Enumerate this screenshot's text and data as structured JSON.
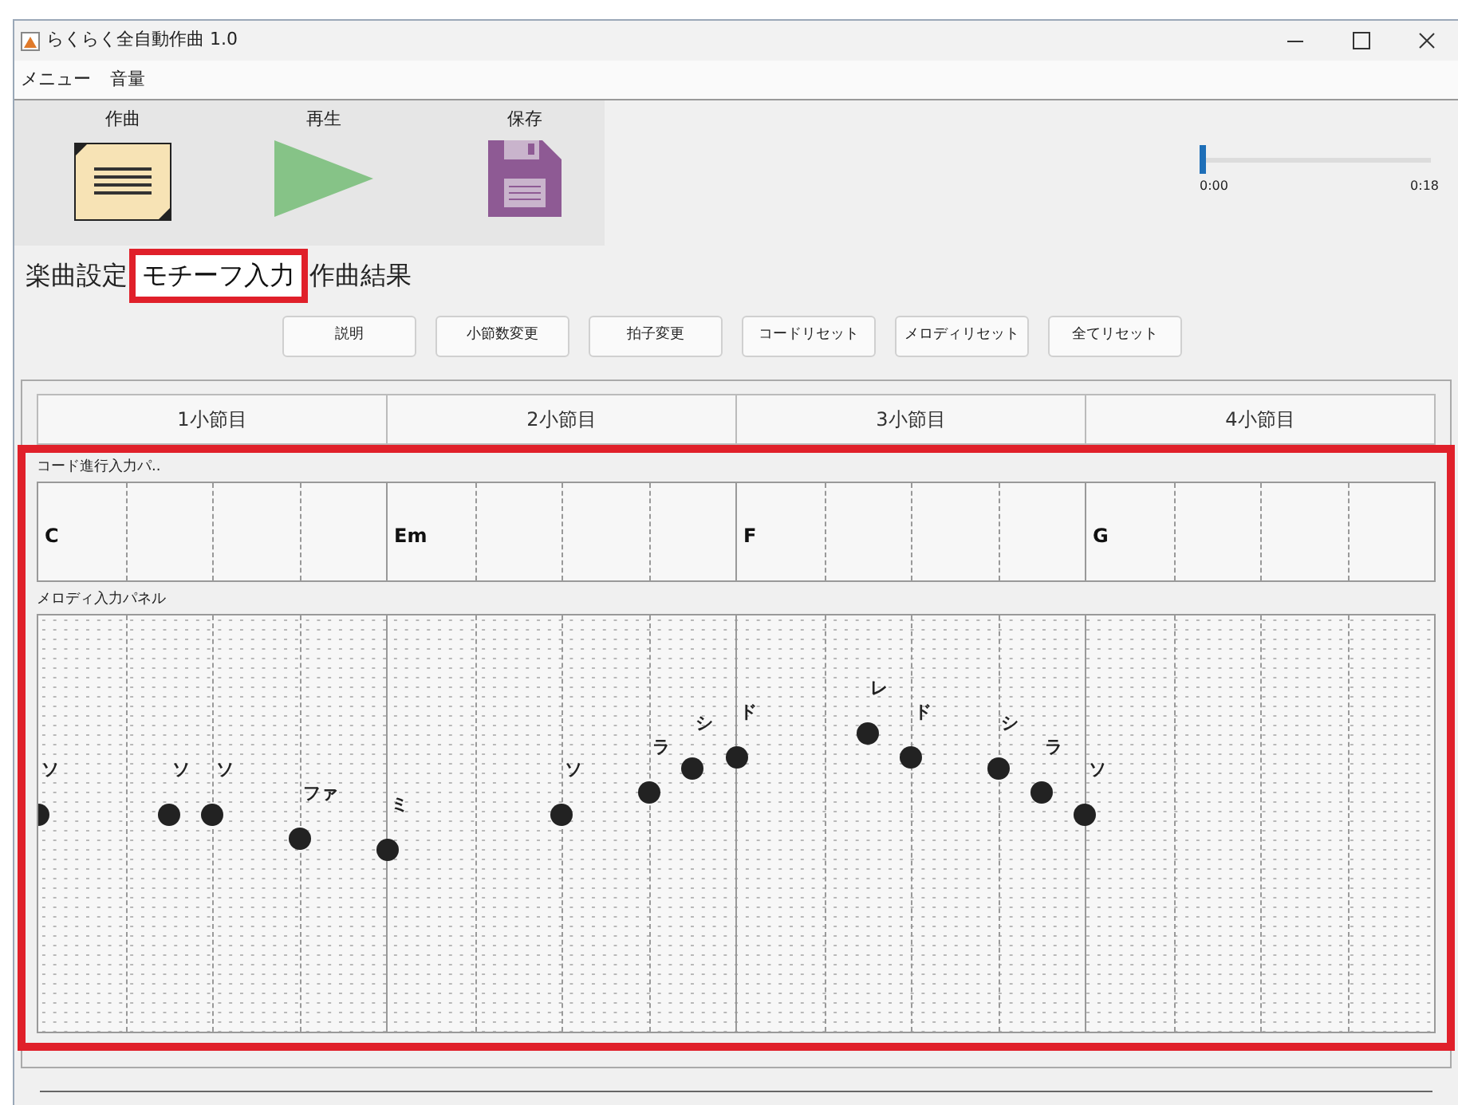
{
  "window": {
    "title": "らくらく全自動作曲 1.0"
  },
  "menu": [
    "メニュー",
    "音量"
  ],
  "toolbar": [
    {
      "kind": "compose",
      "label": "作曲"
    },
    {
      "kind": "play",
      "label": "再生"
    },
    {
      "kind": "save",
      "label": "保存"
    }
  ],
  "playback": {
    "level": 0,
    "start": "0:00",
    "end": "0:18"
  },
  "tabs": [
    {
      "label": "楽曲設定",
      "selected": false
    },
    {
      "label": "モチーフ入力",
      "selected": true
    },
    {
      "label": "作曲結果",
      "selected": false
    }
  ],
  "buttons": [
    "説明",
    "小節数変更",
    "拍子変更",
    "コードリセット",
    "メロディリセット",
    "全てリセット"
  ],
  "chord_panel": {
    "title": "コード進行入力パ.."
  },
  "melody_panel": {
    "title": "メロディ入力パネル"
  },
  "measures": [
    {
      "label": "1小節目",
      "chord": "C",
      "slots": [
        {
          "kind": "g4",
          "label": "ソ"
        },
        {
          "kind": "rest"
        },
        {
          "kind": "rest"
        },
        {
          "kind": "g4",
          "label": "ソ"
        },
        {
          "kind": "g4",
          "label": "ソ"
        },
        {
          "kind": "rest"
        },
        {
          "kind": "f4",
          "label": "ファ"
        },
        {
          "kind": "rest"
        }
      ]
    },
    {
      "label": "2小節目",
      "chord": "Em",
      "slots": [
        {
          "kind": "e4",
          "label": "ミ"
        },
        {
          "kind": "rest"
        },
        {
          "kind": "rest"
        },
        {
          "kind": "rest"
        },
        {
          "kind": "g4",
          "label": "ソ"
        },
        {
          "kind": "rest"
        },
        {
          "kind": "a4",
          "label": "ラ"
        },
        {
          "kind": "b4",
          "label": "シ"
        }
      ]
    },
    {
      "label": "3小節目",
      "chord": "F",
      "slots": [
        {
          "kind": "c5",
          "label": "ド"
        },
        {
          "kind": "rest"
        },
        {
          "kind": "rest"
        },
        {
          "kind": "d5",
          "label": "レ"
        },
        {
          "kind": "c5",
          "label": "ド"
        },
        {
          "kind": "rest"
        },
        {
          "kind": "b4",
          "label": "シ"
        },
        {
          "kind": "a4",
          "label": "ラ"
        }
      ]
    },
    {
      "label": "4小節目",
      "chord": "G",
      "slots": [
        {
          "kind": "g4",
          "label": "ソ"
        },
        {
          "kind": "rest"
        },
        {
          "kind": "rest"
        },
        {
          "kind": "rest"
        },
        {
          "kind": "rest"
        },
        {
          "kind": "rest"
        },
        {
          "kind": "rest"
        },
        {
          "kind": "rest"
        }
      ]
    }
  ]
}
